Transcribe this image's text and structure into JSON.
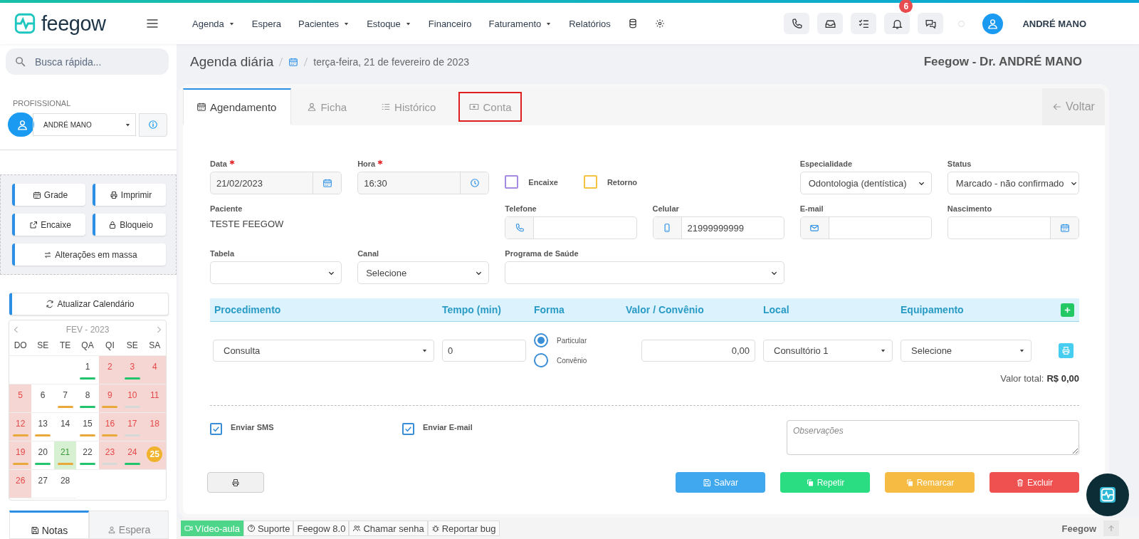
{
  "brand": {
    "name": "feegow"
  },
  "nav": [
    {
      "label": "Agenda",
      "dropdown": true
    },
    {
      "label": "Espera",
      "dropdown": false
    },
    {
      "label": "Pacientes",
      "dropdown": true
    },
    {
      "label": "Estoque",
      "dropdown": true
    },
    {
      "label": "Financeiro",
      "dropdown": false
    },
    {
      "label": "Faturamento",
      "dropdown": true
    },
    {
      "label": "Relatórios",
      "dropdown": false
    }
  ],
  "notifications": {
    "count": "6"
  },
  "user": {
    "name": "ANDRÉ MANO"
  },
  "search": {
    "placeholder": "Busca rápida..."
  },
  "professional": {
    "label": "PROFISSIONAL",
    "value": "ANDRÉ MANO"
  },
  "sidebar_buttons": [
    "Grade",
    "Imprimir",
    "Encaixe",
    "Bloqueio",
    "Alterações em massa"
  ],
  "refresh_button": "Atualizar Calendário",
  "calendar": {
    "title": "FEV - 2023",
    "weekdays": [
      "DO",
      "SE",
      "TE",
      "QA",
      "QI",
      "SE",
      "SA"
    ],
    "days": [
      {
        "kind": "empty"
      },
      {
        "kind": "empty"
      },
      {
        "kind": "empty"
      },
      {
        "day": "1",
        "kind": "normal",
        "color": "#22c56e"
      },
      {
        "day": "2",
        "kind": "off"
      },
      {
        "day": "3",
        "kind": "off",
        "color": "#22c56e"
      },
      {
        "day": "4",
        "kind": "off"
      },
      {
        "day": "5",
        "kind": "off"
      },
      {
        "day": "6",
        "kind": "normal"
      },
      {
        "day": "7",
        "kind": "normal",
        "color": "#e9a93a"
      },
      {
        "day": "8",
        "kind": "normal",
        "color": "#22c56e"
      },
      {
        "day": "9",
        "kind": "off",
        "color": "#e9a93a"
      },
      {
        "day": "10",
        "kind": "off",
        "color": "#d8d8d8"
      },
      {
        "day": "11",
        "kind": "off"
      },
      {
        "day": "12",
        "kind": "off",
        "color": "#e9a93a"
      },
      {
        "day": "13",
        "kind": "normal",
        "color": "#e9a93a"
      },
      {
        "day": "14",
        "kind": "normal"
      },
      {
        "day": "15",
        "kind": "normal",
        "color": "#e9a93a"
      },
      {
        "day": "16",
        "kind": "off",
        "color": "#e9a93a"
      },
      {
        "day": "17",
        "kind": "off",
        "color": "#d8d8d8"
      },
      {
        "day": "18",
        "kind": "off"
      },
      {
        "day": "19",
        "kind": "off",
        "color": "#e9a93a"
      },
      {
        "day": "20",
        "kind": "normal",
        "color": "#22c56e"
      },
      {
        "day": "21",
        "kind": "selected",
        "color": "#e9a93a"
      },
      {
        "day": "22",
        "kind": "normal",
        "color": "#22c56e"
      },
      {
        "day": "23",
        "kind": "off",
        "color": "#d8d8d8"
      },
      {
        "day": "24",
        "kind": "off",
        "color": "#22c56e"
      },
      {
        "day": "25",
        "kind": "today"
      },
      {
        "day": "26",
        "kind": "off"
      },
      {
        "day": "27",
        "kind": "normal"
      },
      {
        "day": "28",
        "kind": "normal"
      }
    ]
  },
  "sidebar_tabs": [
    {
      "label": "Notas",
      "selected": true
    },
    {
      "label": "Espera",
      "selected": false
    }
  ],
  "breadcrumb": {
    "title": "Agenda diária",
    "date": "terça-feira, 21 de fevereiro de 2023"
  },
  "header_right": "Feegow - Dr. ANDRÉ MANO",
  "tabs": [
    {
      "label": "Agendamento",
      "selected": true,
      "highlighted": false
    },
    {
      "label": "Ficha",
      "selected": false,
      "highlighted": false
    },
    {
      "label": "Histórico",
      "selected": false,
      "highlighted": false
    },
    {
      "label": "Conta",
      "selected": false,
      "highlighted": true
    }
  ],
  "back_button": "Voltar",
  "form": {
    "data": {
      "label": "Data",
      "value": "21/02/2023",
      "required": true
    },
    "hora": {
      "label": "Hora",
      "value": "16:30",
      "required": true
    },
    "flags": [
      {
        "label": "Encaixe",
        "checked": false,
        "color": "#a58be0"
      },
      {
        "label": "Retorno",
        "checked": false,
        "color": "#f5c342"
      }
    ],
    "especialidade": {
      "label": "Especialidade",
      "value": "Odontologia (dentística)"
    },
    "status": {
      "label": "Status",
      "value": "Marcado - não confirmado"
    },
    "paciente": {
      "label": "Paciente",
      "value": "TESTE FEEGOW"
    },
    "telefone": {
      "label": "Telefone"
    },
    "celular": {
      "label": "Celular",
      "value": "21999999999"
    },
    "email": {
      "label": "E-mail"
    },
    "nascimento": {
      "label": "Nascimento"
    },
    "tabela": {
      "label": "Tabela"
    },
    "canal": {
      "label": "Canal",
      "value": "Selecione"
    },
    "programa": {
      "label": "Programa de Saúde"
    }
  },
  "procedures": {
    "columns": [
      "Procedimento",
      "Tempo (min)",
      "Forma",
      "Valor / Convênio",
      "Local",
      "Equipamento"
    ],
    "rows": [
      {
        "procedimento": "Consulta",
        "tempo": "0",
        "forma": [
          {
            "label": "Particular",
            "selected": true
          },
          {
            "label": "Convênio",
            "selected": false
          }
        ],
        "valor": "0,00",
        "local": "Consultório 1",
        "equipamento": "Selecione"
      }
    ],
    "total_label": "Valor total:",
    "total": "R$ 0,00"
  },
  "notify": [
    {
      "label": "Enviar SMS",
      "checked": true
    },
    {
      "label": "Enviar E-mail",
      "checked": true
    }
  ],
  "observacoes": {
    "placeholder": "Observações"
  },
  "actions": [
    "Salvar",
    "Repetir",
    "Remarcar",
    "Excluir"
  ],
  "footer": {
    "links": [
      "Vídeo-aula",
      "Suporte",
      "Feegow 8.0",
      "Chamar senha",
      "Reportar bug"
    ],
    "brand": "Feegow"
  }
}
